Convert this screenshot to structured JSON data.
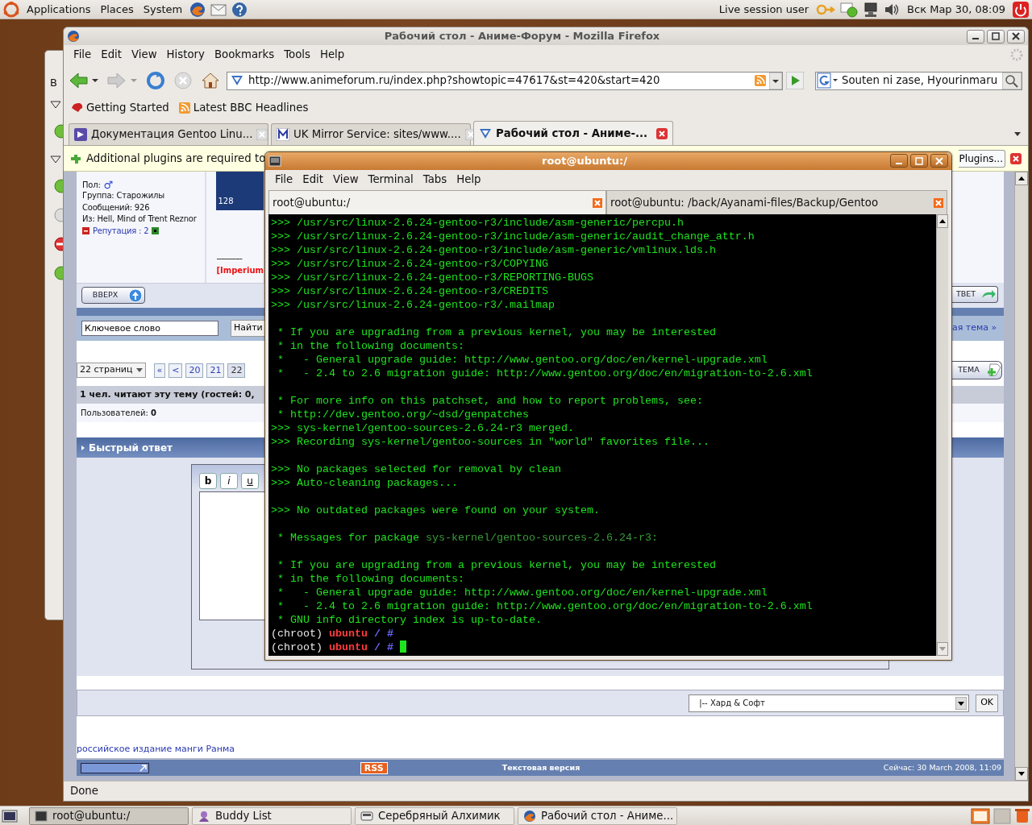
{
  "top_panel": {
    "menus": [
      "Applications",
      "Places",
      "System"
    ],
    "user": "Live session user",
    "clock": "Вск Мар 30, 08:09"
  },
  "background_window": {
    "label": "B",
    "rows": [
      {
        "kind": "group"
      },
      {
        "kind": "online"
      },
      {
        "kind": "group"
      },
      {
        "kind": "online"
      },
      {
        "kind": "offline"
      },
      {
        "kind": "busy"
      },
      {
        "kind": "online"
      }
    ]
  },
  "firefox": {
    "title": "Рабочий стол - Аниме-Форум - Mozilla Firefox",
    "menu": [
      "File",
      "Edit",
      "View",
      "History",
      "Bookmarks",
      "Tools",
      "Help"
    ],
    "url": "http://www.animeforum.ru/index.php?showtopic=47617&st=420&start=420",
    "search": "Souten ni zase, Hyourinmaru",
    "bookmarks": [
      "Getting Started",
      "Latest BBC Headlines"
    ],
    "tabs": [
      {
        "label": "Документация Gentoo Linu...",
        "selected": false
      },
      {
        "label": "UK Mirror Service: sites/www....",
        "selected": false
      },
      {
        "label": "Рабочий стол - Аниме-...",
        "selected": true
      }
    ],
    "notification": {
      "text": "Additional plugins are required to",
      "button": "Plugins..."
    },
    "forum": {
      "profile": [
        "Пол:",
        "Группа: Старожилы",
        "Сообщений: 926",
        "Из: Hell, Mind of Trent Reznor"
      ],
      "gender_symbol": "♂",
      "reputation": "Репутация : 2",
      "avatar_caption": "128",
      "signature_rule": "------------",
      "signature": "[Imperium",
      "top_button": "ВВЕРХ",
      "reply_button": "ТВЕТ",
      "search_value": "Ключевое слово",
      "search_button": "Найти",
      "next_topic": "ая тема »",
      "pages_dropdown": "22 страниц",
      "pages": [
        {
          "label": "«",
          "selected": false
        },
        {
          "label": "<",
          "selected": false
        },
        {
          "label": "20",
          "selected": false
        },
        {
          "label": "21",
          "selected": false
        },
        {
          "label": "22",
          "selected": true
        }
      ],
      "new_topic_button": "ТЕМА",
      "readers": "1 чел. читают эту тему (гостей: 0,",
      "users": "Пользователей: **0**",
      "quick_reply": "Быстрый ответ",
      "editor_buttons": [
        "b",
        "i",
        "u"
      ],
      "forum_select": "|-- Хард & Софт",
      "ok_button": "OK",
      "link": "российское издание манги Ранма",
      "rss": "RSS",
      "text_version": "Текстовая версия",
      "now": "Сейчас: 30 March 2008, 11:09"
    },
    "status": "Done"
  },
  "terminal": {
    "title": "root@ubuntu:/",
    "menu": [
      "File",
      "Edit",
      "View",
      "Terminal",
      "Tabs",
      "Help"
    ],
    "tabs": [
      {
        "label": "root@ubuntu:/",
        "selected": true
      },
      {
        "label": "root@ubuntu: /back/Ayanami-files/Backup/Gentoo",
        "selected": false
      }
    ],
    "blocks": [
      {
        "lines": [
          {
            "cursor": false,
            "segments": [
              {
                "kind": "green",
                "text": ">>> /usr/src/linux-2.6.24-gentoo-r3/include/asm-generic/percpu.h"
              }
            ]
          },
          {
            "cursor": false,
            "segments": [
              {
                "kind": "green",
                "text": ">>> /usr/src/linux-2.6.24-gentoo-r3/include/asm-generic/audit_change_attr.h"
              }
            ]
          },
          {
            "cursor": false,
            "segments": [
              {
                "kind": "green",
                "text": ">>> /usr/src/linux-2.6.24-gentoo-r3/include/asm-generic/vmlinux.lds.h"
              }
            ]
          },
          {
            "cursor": false,
            "segments": [
              {
                "kind": "green",
                "text": ">>> /usr/src/linux-2.6.24-gentoo-r3/COPYING"
              }
            ]
          },
          {
            "cursor": false,
            "segments": [
              {
                "kind": "green",
                "text": ">>> /usr/src/linux-2.6.24-gentoo-r3/REPORTING-BUGS"
              }
            ]
          },
          {
            "cursor": false,
            "segments": [
              {
                "kind": "green",
                "text": ">>> /usr/src/linux-2.6.24-gentoo-r3/CREDITS"
              }
            ]
          },
          {
            "cursor": false,
            "segments": [
              {
                "kind": "green",
                "text": ">>> /usr/src/linux-2.6.24-gentoo-r3/.mailmap"
              }
            ]
          }
        ]
      },
      {
        "lines": [
          {
            "cursor": false,
            "segments": [
              {
                "kind": "green",
                "text": " * If you are upgrading from a previous kernel, you may be interested"
              }
            ]
          },
          {
            "cursor": false,
            "segments": [
              {
                "kind": "green",
                "text": " * in the following documents:"
              }
            ]
          },
          {
            "cursor": false,
            "segments": [
              {
                "kind": "green",
                "text": " *   - General upgrade guide: http://www.gentoo.org/doc/en/kernel-upgrade.xml"
              }
            ]
          },
          {
            "cursor": false,
            "segments": [
              {
                "kind": "green",
                "text": " *   - 2.4 to 2.6 migration guide: http://www.gentoo.org/doc/en/migration-to-2.6.xml"
              }
            ]
          }
        ]
      },
      {
        "lines": [
          {
            "cursor": false,
            "segments": [
              {
                "kind": "green",
                "text": " * For more info on this patchset, and how to report problems, see:"
              }
            ]
          },
          {
            "cursor": false,
            "segments": [
              {
                "kind": "green",
                "text": " * http://dev.gentoo.org/~dsd/genpatches"
              }
            ]
          },
          {
            "cursor": false,
            "segments": [
              {
                "kind": "green",
                "text": ">>> sys-kernel/gentoo-sources-2.6.24-r3 merged."
              }
            ]
          },
          {
            "cursor": false,
            "segments": [
              {
                "kind": "green",
                "text": ">>> Recording sys-kernel/gentoo-sources in \"world\" favorites file..."
              }
            ]
          }
        ]
      },
      {
        "lines": [
          {
            "cursor": false,
            "segments": [
              {
                "kind": "green",
                "text": ">>> No packages selected for removal by clean"
              }
            ]
          },
          {
            "cursor": false,
            "segments": [
              {
                "kind": "green",
                "text": ">>> Auto-cleaning packages..."
              }
            ]
          }
        ]
      },
      {
        "lines": [
          {
            "cursor": false,
            "segments": [
              {
                "kind": "green",
                "text": ">>> No outdated packages were found on your system."
              }
            ]
          }
        ]
      },
      {
        "lines": [
          {
            "cursor": false,
            "segments": [
              {
                "kind": "green",
                "text": " * Messages for package "
              },
              {
                "kind": "dim",
                "text": "sys-kernel/gentoo-sources-2.6.24-r3:"
              }
            ]
          }
        ]
      },
      {
        "lines": [
          {
            "cursor": false,
            "segments": [
              {
                "kind": "green",
                "text": " * If you are upgrading from a previous kernel, you may be interested"
              }
            ]
          },
          {
            "cursor": false,
            "segments": [
              {
                "kind": "green",
                "text": " * in the following documents:"
              }
            ]
          },
          {
            "cursor": false,
            "segments": [
              {
                "kind": "green",
                "text": " *   - General upgrade guide: http://www.gentoo.org/doc/en/kernel-upgrade.xml"
              }
            ]
          },
          {
            "cursor": false,
            "segments": [
              {
                "kind": "green",
                "text": " *   - 2.4 to 2.6 migration guide: http://www.gentoo.org/doc/en/migration-to-2.6.xml"
              }
            ]
          },
          {
            "cursor": false,
            "segments": [
              {
                "kind": "green",
                "text": " * GNU info directory index is up-to-date."
              }
            ]
          },
          {
            "cursor": false,
            "segments": [
              {
                "kind": "white",
                "text": "(chroot) "
              },
              {
                "kind": "host",
                "text": "ubuntu"
              },
              {
                "kind": "path",
                "text": " / #"
              }
            ]
          },
          {
            "cursor": true,
            "segments": [
              {
                "kind": "white",
                "text": "(chroot) "
              },
              {
                "kind": "host",
                "text": "ubuntu"
              },
              {
                "kind": "path",
                "text": " / #"
              }
            ]
          }
        ]
      }
    ]
  },
  "taskbar": [
    {
      "label": "root@ubuntu:/",
      "selected": true
    },
    {
      "label": "Buddy List",
      "selected": false
    },
    {
      "label": "Серебряный Алхимик",
      "selected": false
    },
    {
      "label": "Рабочий стол - Аниме...",
      "selected": false
    }
  ]
}
